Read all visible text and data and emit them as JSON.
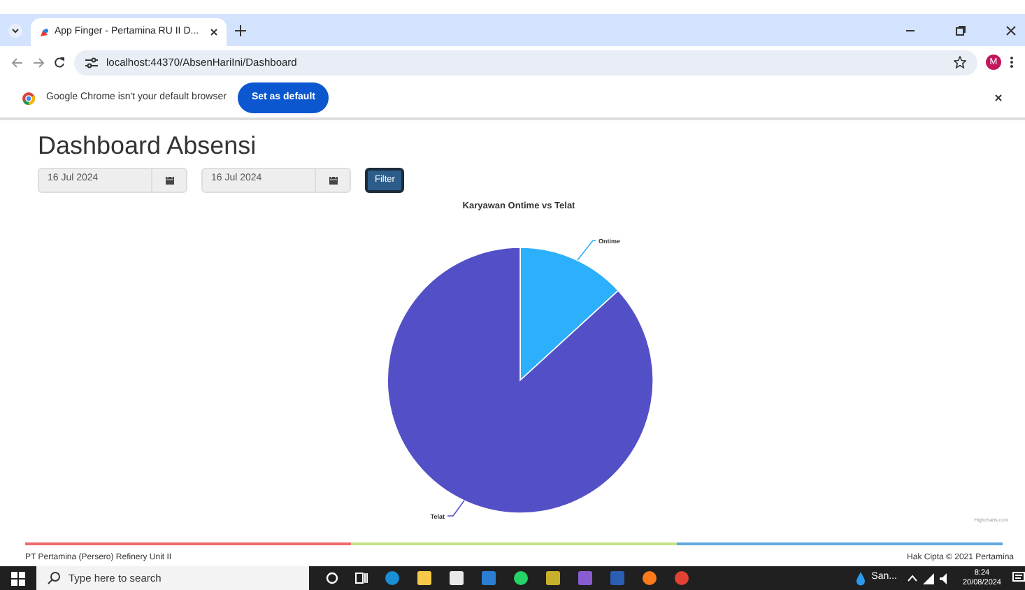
{
  "browser": {
    "tab_title": "App Finger - Pertamina RU II D...",
    "address": "localhost:44370/AbsenHariIni/Dashboard",
    "infobar": {
      "message": "Google Chrome isn't your default browser",
      "button": "Set as default"
    },
    "profile_initial": "M"
  },
  "page": {
    "title": "Dashboard Absensi",
    "filters": [
      {
        "value": "16 Jul 2024"
      },
      {
        "value": "16 Jul 2024"
      }
    ],
    "filter_button": "Filter"
  },
  "chart": {
    "title": "Karyawan Ontime vs Telat",
    "slices": [
      {
        "label": "Ontime",
        "color": "#2db0fb"
      },
      {
        "label": "Telat",
        "color": "#5350c7"
      }
    ],
    "credit": "Highcharts.com"
  },
  "footer": {
    "left": "PT Pertamina (Persero) Refinery Unit II",
    "right": "Hak Cipta © 2021 Pertamina"
  },
  "taskbar": {
    "search_placeholder": "Type here to search",
    "weather": "San...",
    "time": "8:24",
    "date": "20/08/2024"
  }
}
